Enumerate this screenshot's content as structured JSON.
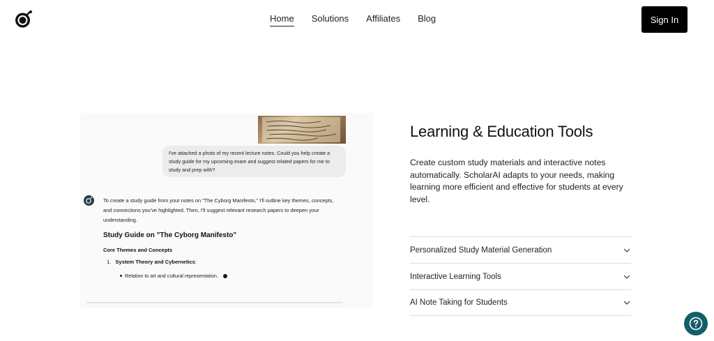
{
  "header": {
    "logo_icon": "bomb-logo-icon",
    "nav": [
      {
        "label": "Home",
        "active": true
      },
      {
        "label": "Solutions",
        "active": false
      },
      {
        "label": "Affiliates",
        "active": false
      },
      {
        "label": "Blog",
        "active": false
      }
    ],
    "sign_in_label": "Sign In"
  },
  "chat": {
    "user_message": "I've attached a photo of my recent lecture notes. Could you help create a study guide for my upcoming exam and suggest related papers for me to study and prep with?",
    "ai_intro": "To create a study guide from your notes on \"The Cyborg Manifesto,\" I'll outline key themes, concepts, and connections you've highlighted. Then, I'll suggest relevant research papers to deepen your understanding.",
    "guide_title": "Study Guide on \"The Cyborg Manifesto\"",
    "section_title": "Core Themes and Concepts",
    "list_item_number": "1.",
    "list_item_label": "System Theory and Cybernetics",
    "list_item_suffix": ":",
    "sub_bullet": "Relation to art and cultural representation."
  },
  "feature": {
    "title": "Learning & Education Tools",
    "description": "Create custom study materials and interactive notes automatically. ScholarAI adapts to your needs, making learning more efficient and effective for students at every level.",
    "accordion": [
      {
        "label": "Personalized Study Material Generation",
        "icon": "chevron-down-icon"
      },
      {
        "label": "Interactive Learning Tools",
        "icon": "chevron-down-icon"
      },
      {
        "label": "AI Note Taking for Students",
        "icon": "chevron-down-icon"
      }
    ]
  },
  "help_icon": "question-circle-icon",
  "colors": {
    "sign_in_bg": "#000000",
    "help_bg": "#135e68",
    "bubble_bg": "#ececec"
  }
}
